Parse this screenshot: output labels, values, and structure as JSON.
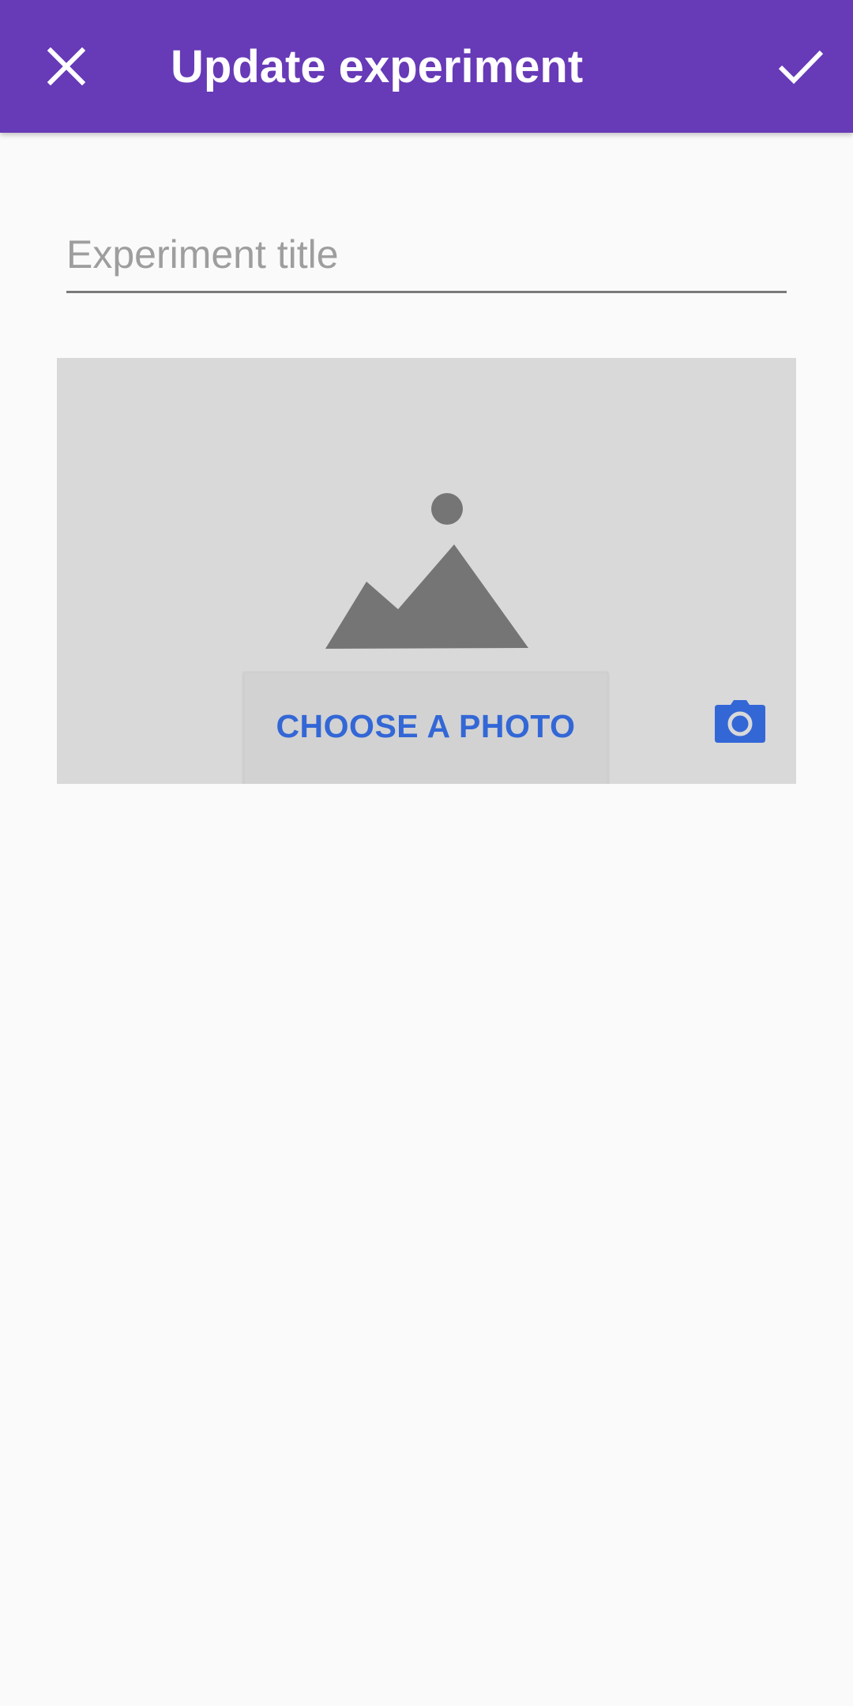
{
  "app_bar": {
    "title": "Update experiment",
    "close_icon": "close-icon",
    "confirm_icon": "check-icon",
    "background_color": "#673ab7"
  },
  "form": {
    "title_field": {
      "placeholder": "Experiment title",
      "value": ""
    }
  },
  "photo": {
    "placeholder_icon": "image-placeholder-icon",
    "choose_label": "CHOOSE A PHOTO",
    "camera_icon": "camera-icon",
    "accent_color": "#3367d6"
  }
}
